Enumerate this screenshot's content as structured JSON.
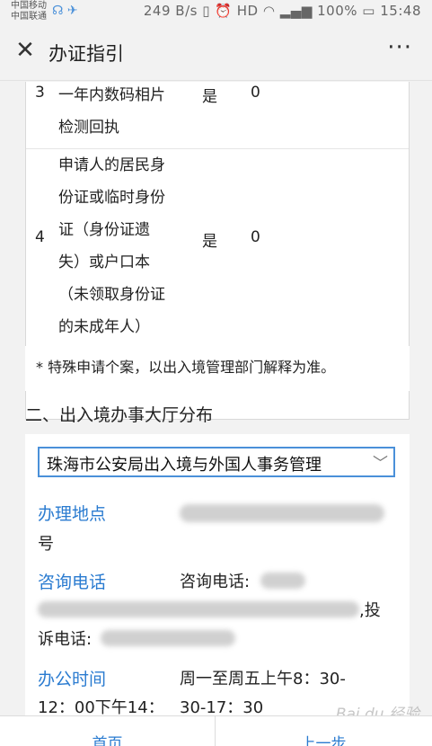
{
  "status_bar": {
    "carrier1": "中国移动",
    "carrier2": "中国联通",
    "speed": "249 B/s",
    "battery": "100%",
    "time": "15:48"
  },
  "header": {
    "close_icon": "close-icon",
    "title": "办证指引",
    "more_icon": "ellipsis-icon"
  },
  "table": {
    "rows": [
      {
        "no": "3",
        "name_lines": [
          "一年内数码相片",
          "检测回执"
        ],
        "required": "是",
        "qty": "0"
      },
      {
        "no": "4",
        "name_lines": [
          "申请人的居民身",
          "份证或临时身份",
          "证（身份证遗",
          "失）或户口本",
          "（未领取身份证",
          "的未成年人）"
        ],
        "required": "是",
        "qty": "0"
      }
    ]
  },
  "note": "* 特殊申请个案，以出入境管理部门解释为准。",
  "section2": {
    "heading": "二、出入境办事大厅分布",
    "selected_hall": "珠海市公安局出入境与外国人事务管理",
    "fields": {
      "location_label": "办理地点",
      "location_suffix": "号",
      "phone_label": "咨询电话",
      "phone_prefix": "咨询电话:",
      "complaint_suffix": ",投",
      "complaint_prefix": "诉电话:",
      "hours_label": "办公时间",
      "hours_line1": "周一至周五上午8：30-",
      "hours_line2_a": "12：00下午14：",
      "hours_line2_b": "30-17：30"
    }
  },
  "bottom_bar": {
    "home": "首页",
    "prev": "上一步"
  },
  "watermark": "Bai du 经验"
}
